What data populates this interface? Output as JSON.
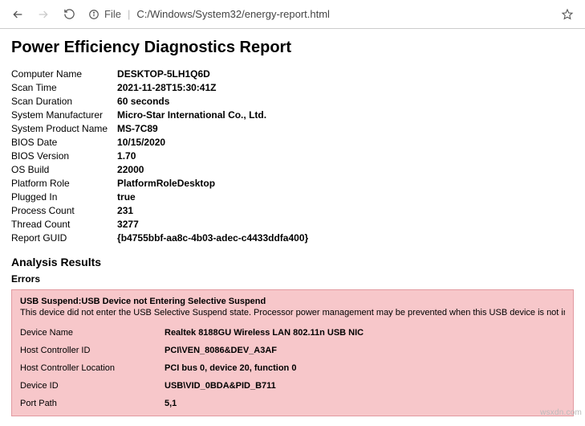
{
  "toolbar": {
    "file_label": "File",
    "url": "C:/Windows/System32/energy-report.html"
  },
  "report": {
    "title": "Power Efficiency Diagnostics Report",
    "meta": [
      {
        "label": "Computer Name",
        "value": "DESKTOP-5LH1Q6D"
      },
      {
        "label": "Scan Time",
        "value": "2021-11-28T15:30:41Z"
      },
      {
        "label": "Scan Duration",
        "value": "60 seconds"
      },
      {
        "label": "System Manufacturer",
        "value": "Micro-Star International Co., Ltd."
      },
      {
        "label": "System Product Name",
        "value": "MS-7C89"
      },
      {
        "label": "BIOS Date",
        "value": "10/15/2020"
      },
      {
        "label": "BIOS Version",
        "value": "1.70"
      },
      {
        "label": "OS Build",
        "value": "22000"
      },
      {
        "label": "Platform Role",
        "value": "PlatformRoleDesktop"
      },
      {
        "label": "Plugged In",
        "value": "true"
      },
      {
        "label": "Process Count",
        "value": "231"
      },
      {
        "label": "Thread Count",
        "value": "3277"
      },
      {
        "label": "Report GUID",
        "value": "{b4755bbf-aa8c-4b03-adec-c4433ddfa400}"
      }
    ],
    "analysis_heading": "Analysis Results",
    "errors_heading": "Errors",
    "error": {
      "title": "USB Suspend:USB Device not Entering Selective Suspend",
      "desc": "This device did not enter the USB Selective Suspend state. Processor power management may be prevented when this USB device is not in the Suspend state. Note that this issue will not prevent the system from sleeping.",
      "rows": [
        {
          "label": "Device Name",
          "value": "Realtek 8188GU Wireless LAN 802.11n USB NIC"
        },
        {
          "label": "Host Controller ID",
          "value": "PCI\\VEN_8086&DEV_A3AF"
        },
        {
          "label": "Host Controller Location",
          "value": "PCI bus 0, device 20, function 0"
        },
        {
          "label": "Device ID",
          "value": "USB\\VID_0BDA&PID_B711"
        },
        {
          "label": "Port Path",
          "value": "5,1"
        }
      ]
    }
  },
  "watermark": "wsxdn.com"
}
